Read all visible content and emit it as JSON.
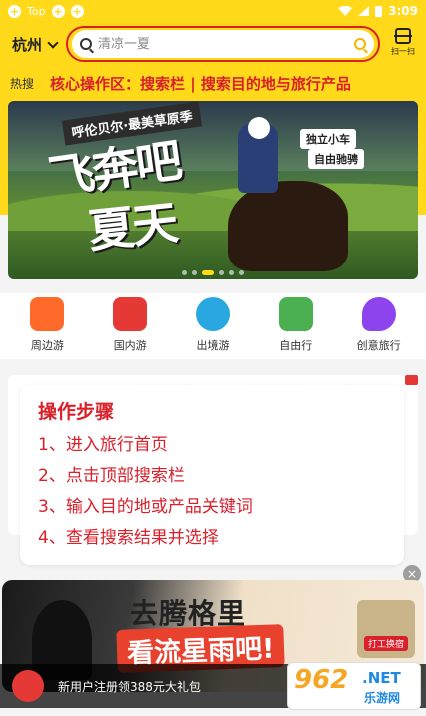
{
  "status_bar": {
    "left_label": "Top",
    "time": "3:09"
  },
  "header": {
    "city": "杭州",
    "search_placeholder": "清凉一夏",
    "scan_label": "扫一扫"
  },
  "hot": {
    "label": "热搜",
    "annotation": "核心操作区：搜索栏 | 搜索目的地与旅行产品"
  },
  "banner": {
    "subtitle": "呼伦贝尔·最美草原季",
    "headline_line1": "飞奔吧",
    "headline_line2": "夏天",
    "tag1": "独立小车",
    "tag2": "自由驰骋"
  },
  "categories": [
    {
      "label": "周边游",
      "icon": "suitcase-icon",
      "color": "#ff6a2b"
    },
    {
      "label": "国内游",
      "icon": "pagoda-icon",
      "color": "#e53935"
    },
    {
      "label": "出境游",
      "icon": "plane-icon",
      "color": "#29a7e0"
    },
    {
      "label": "自由行",
      "icon": "luggage-icon",
      "color": "#4caf50"
    },
    {
      "label": "创意旅行",
      "icon": "rocket-icon",
      "color": "#8e44ec"
    }
  ],
  "steps": {
    "title": "操作步骤",
    "items": [
      "1、进入旅行首页",
      "2、点击顶部搜索栏",
      "3、输入目的地或产品关键词",
      "4、查看搜索结果并选择"
    ]
  },
  "ad": {
    "title": "去腾格里",
    "subtitle": "看流星雨吧!",
    "badge_label": "打工换宿",
    "close": "×"
  },
  "new_user": {
    "text": "新用户注册领388元大礼包"
  },
  "watermark": {
    "number": "962",
    "dot_net": ".NET",
    "cn": "乐游网"
  }
}
